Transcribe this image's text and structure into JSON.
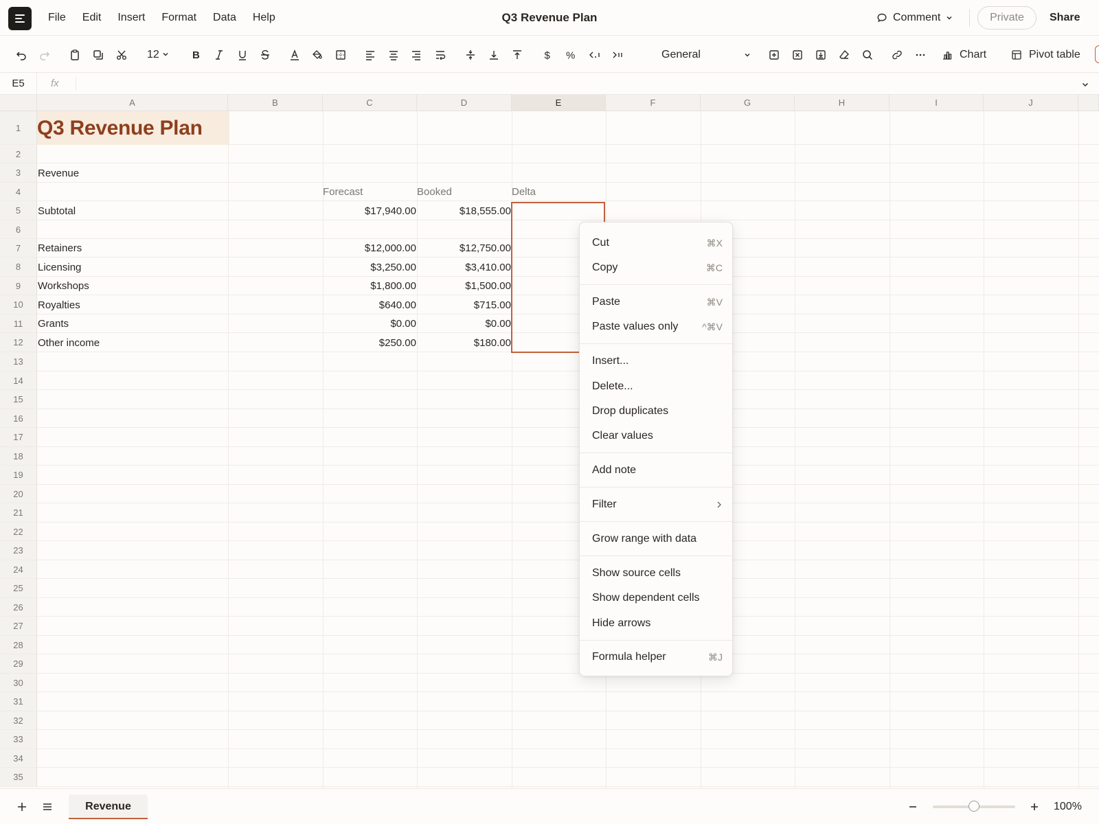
{
  "app": {
    "doc_title": "Q3 Revenue Plan",
    "menu": [
      "File",
      "Edit",
      "Insert",
      "Format",
      "Data",
      "Help"
    ],
    "comment_label": "Comment",
    "private_label": "Private",
    "share_label": "Share"
  },
  "toolbar": {
    "font_size": "12",
    "number_format": "General",
    "chart_label": "Chart",
    "pivot_label": "Pivot table"
  },
  "formula_bar": {
    "cell_ref": "E5",
    "fx_label": "fx",
    "value": ""
  },
  "columns": [
    "A",
    "B",
    "C",
    "D",
    "E",
    "F",
    "G",
    "H",
    "I",
    "J"
  ],
  "selected_column": "E",
  "rows": [
    "1",
    "2",
    "3",
    "4",
    "5",
    "6",
    "7",
    "8",
    "9",
    "10",
    "11",
    "12",
    "13",
    "14",
    "15",
    "16",
    "17",
    "18",
    "19",
    "20",
    "21",
    "22",
    "23",
    "24",
    "25",
    "26",
    "27",
    "28",
    "29",
    "30",
    "31",
    "32",
    "33",
    "34",
    "35"
  ],
  "sheet": {
    "title": "Q3 Revenue Plan",
    "section": "Revenue",
    "col_headers": {
      "forecast": "Forecast",
      "booked": "Booked",
      "delta": "Delta"
    },
    "subtotal": {
      "label": "Subtotal",
      "forecast": "$17,940.00",
      "booked": "$18,555.00"
    },
    "lines": [
      {
        "label": "Retainers",
        "forecast": "$12,000.00",
        "booked": "$12,750.00"
      },
      {
        "label": "Licensing",
        "forecast": "$3,250.00",
        "booked": "$3,410.00"
      },
      {
        "label": "Workshops",
        "forecast": "$1,800.00",
        "booked": "$1,500.00"
      },
      {
        "label": "Royalties",
        "forecast": "$640.00",
        "booked": "$715.00"
      },
      {
        "label": "Grants",
        "forecast": "$0.00",
        "booked": "$0.00"
      },
      {
        "label": "Other income",
        "forecast": "$250.00",
        "booked": "$180.00"
      }
    ],
    "selection": "E5:E12"
  },
  "context_menu": {
    "cut": {
      "label": "Cut",
      "shortcut": "⌘X"
    },
    "copy": {
      "label": "Copy",
      "shortcut": "⌘C"
    },
    "paste": {
      "label": "Paste",
      "shortcut": "⌘V"
    },
    "paste_values": {
      "label": "Paste values only",
      "shortcut": "^⌘V"
    },
    "insert": {
      "label": "Insert..."
    },
    "delete": {
      "label": "Delete..."
    },
    "drop_duplicates": {
      "label": "Drop duplicates"
    },
    "clear_values": {
      "label": "Clear values"
    },
    "add_note": {
      "label": "Add note"
    },
    "filter": {
      "label": "Filter"
    },
    "grow_range": {
      "label": "Grow range with data"
    },
    "show_source": {
      "label": "Show source cells"
    },
    "show_dependent": {
      "label": "Show dependent cells"
    },
    "hide_arrows": {
      "label": "Hide arrows"
    },
    "formula_helper": {
      "label": "Formula helper",
      "shortcut": "⌘J"
    }
  },
  "bottom": {
    "sheet_tab": "Revenue",
    "zoom": "100%"
  },
  "colors": {
    "accent": "#c2603a",
    "title_text": "#8e3f1e",
    "title_fill": "#f8ecdf"
  },
  "icons": [
    "menu-icon",
    "comment-icon",
    "undo-icon",
    "redo-icon",
    "paste-icon",
    "copy-icon",
    "cut-icon",
    "bold-icon",
    "italic-icon",
    "underline-icon",
    "strikethrough-icon",
    "text-color-icon",
    "fill-color-icon",
    "borders-icon",
    "align-left-icon",
    "align-center-icon",
    "align-right-icon",
    "wrap-icon",
    "valign-middle-icon",
    "valign-bottom-icon",
    "valign-top-icon",
    "currency-icon",
    "percent-icon",
    "decrease-decimal-icon",
    "increase-decimal-icon",
    "insert-icon",
    "delete-icon",
    "import-icon",
    "clear-icon",
    "search-icon",
    "link-icon",
    "more-icon",
    "chart-icon",
    "pivot-icon",
    "add-sheet-icon",
    "sheet-list-icon",
    "zoom-out-icon",
    "zoom-in-icon"
  ]
}
